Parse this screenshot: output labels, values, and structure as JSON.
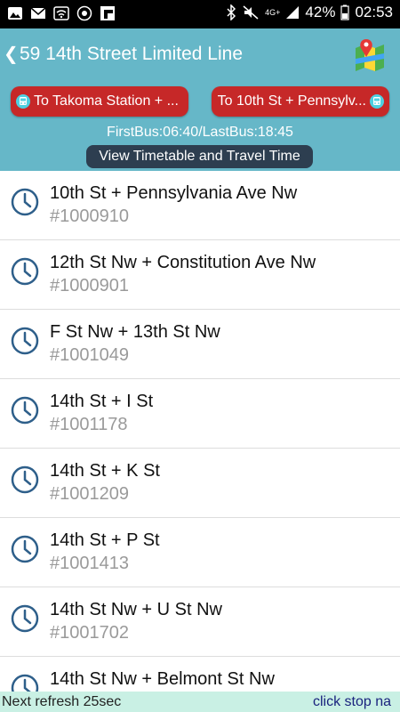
{
  "status_bar": {
    "battery": "42%",
    "time": "02:53",
    "network": "4G+"
  },
  "header": {
    "back_icon": "chevron-left-icon",
    "title": "59 14th Street Limited Line",
    "map_icon": "map-icon",
    "directions": [
      {
        "label": "To Takoma Station + ..."
      },
      {
        "label": "To 10th St + Pennsylv..."
      }
    ],
    "bus_times": "FirstBus:06:40/LastBus:18:45",
    "timetable_label": "View Timetable and Travel Time"
  },
  "stops": [
    {
      "name": "10th St + Pennsylvania Ave Nw",
      "id": "#1000910"
    },
    {
      "name": "12th St Nw + Constitution Ave Nw",
      "id": "#1000901"
    },
    {
      "name": "F St Nw + 13th St Nw",
      "id": "#1001049"
    },
    {
      "name": "14th St + I St",
      "id": "#1001178"
    },
    {
      "name": "14th St + K St",
      "id": "#1001209"
    },
    {
      "name": "14th St + P St",
      "id": "#1001413"
    },
    {
      "name": "14th St Nw + U St Nw",
      "id": "#1001702"
    },
    {
      "name": "14th St Nw + Belmont St Nw",
      "id": ""
    }
  ],
  "footer": {
    "refresh": "Next refresh 25sec",
    "hint": "click stop na"
  },
  "colors": {
    "header": "#66b7c8",
    "direction_button": "#c62828",
    "timetable_button": "#2d3e50",
    "clock": "#2e5f8a",
    "footer": "#c9f0e4"
  }
}
